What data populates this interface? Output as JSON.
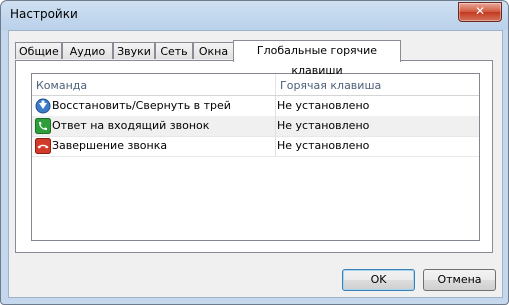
{
  "window": {
    "title": "Настройки",
    "close_glyph": "✕"
  },
  "tabs": [
    {
      "label": "Общие"
    },
    {
      "label": "Аудио"
    },
    {
      "label": "Звуки"
    },
    {
      "label": "Сеть"
    },
    {
      "label": "Окна"
    },
    {
      "label": "Глобальные горячие клавиши",
      "active": true
    }
  ],
  "hotkeys": {
    "columns": [
      "Команда",
      "Горячая клавиша"
    ],
    "rows": [
      {
        "icon": "restore-tray-icon",
        "command": "Восстановить/Свернуть в трей",
        "hotkey": "Не установлено"
      },
      {
        "icon": "answer-call-icon",
        "command": "Ответ на входящий звонок",
        "hotkey": "Не установлено"
      },
      {
        "icon": "end-call-icon",
        "command": "Завершение звонка",
        "hotkey": "Не установлено"
      }
    ]
  },
  "buttons": {
    "ok": "OK",
    "cancel": "Отмена"
  },
  "colors": {
    "answer": "#2e9e3a",
    "end": "#d23a2a",
    "tray": "#2f6fb8"
  }
}
